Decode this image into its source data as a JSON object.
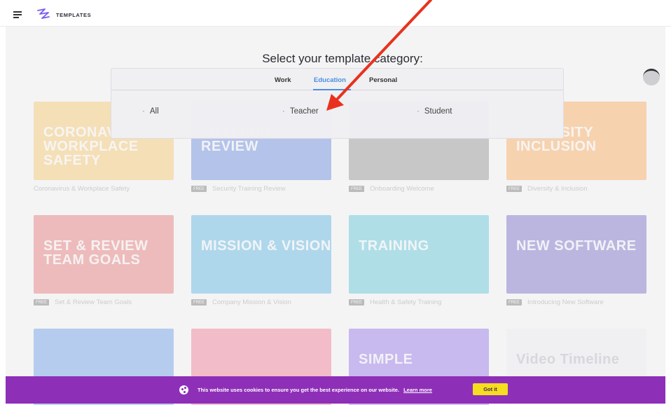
{
  "app": {
    "brand": "TEMPLATES"
  },
  "heading": "Select your template category:",
  "tabs": [
    {
      "label": "Work",
      "active": false
    },
    {
      "label": "Education",
      "active": true
    },
    {
      "label": "Personal",
      "active": false
    }
  ],
  "options": [
    "All",
    "Teacher",
    "Student"
  ],
  "cards": [
    {
      "title": "Coronavirus & Workplace Safety",
      "badge": "",
      "thumb_text": "CORONAVIRUS & WORKPLACE SAFETY",
      "color": "#f5b335"
    },
    {
      "title": "Security Training Review",
      "badge": "FREE",
      "thumb_text": "TRAINING REVIEW",
      "color": "#2d5ccf"
    },
    {
      "title": "Onboarding Welcome",
      "badge": "FREE",
      "thumb_text": "",
      "color": "#6a6a6a"
    },
    {
      "title": "Diversity & Inclusion",
      "badge": "FREE",
      "thumb_text": "DIVERSITY INCLUSION",
      "color": "#ff8c1a"
    },
    {
      "title": "Set & Review Team Goals",
      "badge": "FREE",
      "thumb_text": "SET & REVIEW TEAM GOALS",
      "color": "#e0443f"
    },
    {
      "title": "Company Mission & Vision",
      "badge": "FREE",
      "thumb_text": "MISSION & VISION",
      "color": "#1f9bd6"
    },
    {
      "title": "Health & Safety Training",
      "badge": "FREE",
      "thumb_text": "TRAINING",
      "color": "#1fb0c9"
    },
    {
      "title": "Introducing New Software",
      "badge": "FREE",
      "thumb_text": "NEW SOFTWARE",
      "color": "#3f35b5"
    },
    {
      "title": "",
      "badge": "",
      "thumb_text": "",
      "color": "#2f79e0"
    },
    {
      "title": "",
      "badge": "",
      "thumb_text": "",
      "color": "#ee4a6a"
    },
    {
      "title": "",
      "badge": "",
      "thumb_text": "SIMPLE",
      "color": "#6b3de0"
    },
    {
      "title": "",
      "badge": "",
      "thumb_text": "Video Timeline",
      "color": "#e9e9ee"
    }
  ],
  "cookie": {
    "text": "This website uses cookies to ensure you get the best experience on our website.",
    "link": "Learn more",
    "button": "Got it"
  },
  "colors": {
    "accent": "#4a8fdd",
    "cookie_bg": "#8e2fb8",
    "cookie_button": "#f6dd1e",
    "arrow": "#e8321e"
  }
}
